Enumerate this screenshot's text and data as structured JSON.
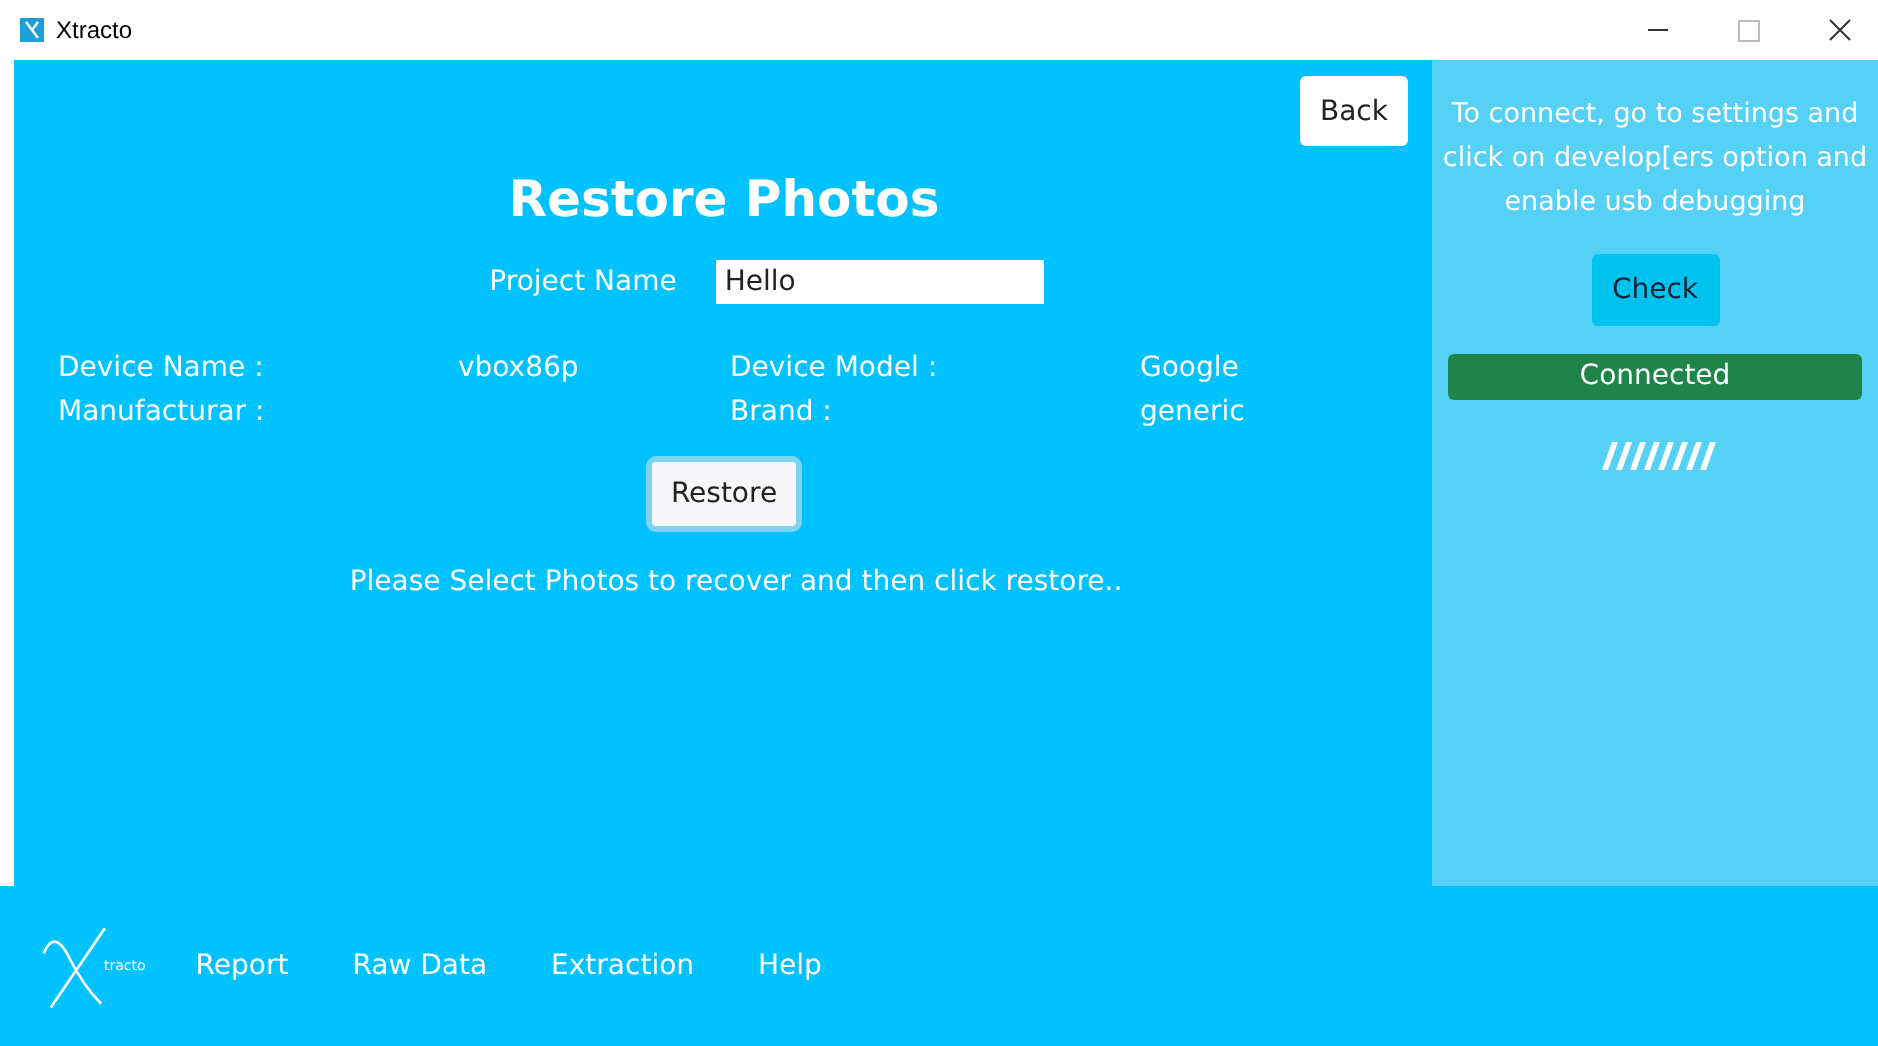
{
  "window": {
    "title": "Xtracto"
  },
  "back_button": "Back",
  "title": "Restore Photos",
  "project": {
    "label": "Project Name",
    "value": "Hello"
  },
  "device_info": [
    {
      "label": "Device Name :",
      "value": "vbox86p"
    },
    {
      "label": "Device Model :",
      "value": "Google"
    },
    {
      "label": "Manufacturar :"
    },
    {
      "label": "Brand :",
      "value": "generic"
    }
  ],
  "restore_button": "Restore",
  "message": "Please Select Photos to recover and then click restore..",
  "side_panel": {
    "instructions": "To connect, go to settings and click on develop[ers option and enable usb debugging",
    "check_button": "Check",
    "status": "Connected"
  },
  "nav": {
    "logo_text": "tracto",
    "items": [
      "Report",
      "Raw Data",
      "Extraction",
      "Help"
    ]
  }
}
